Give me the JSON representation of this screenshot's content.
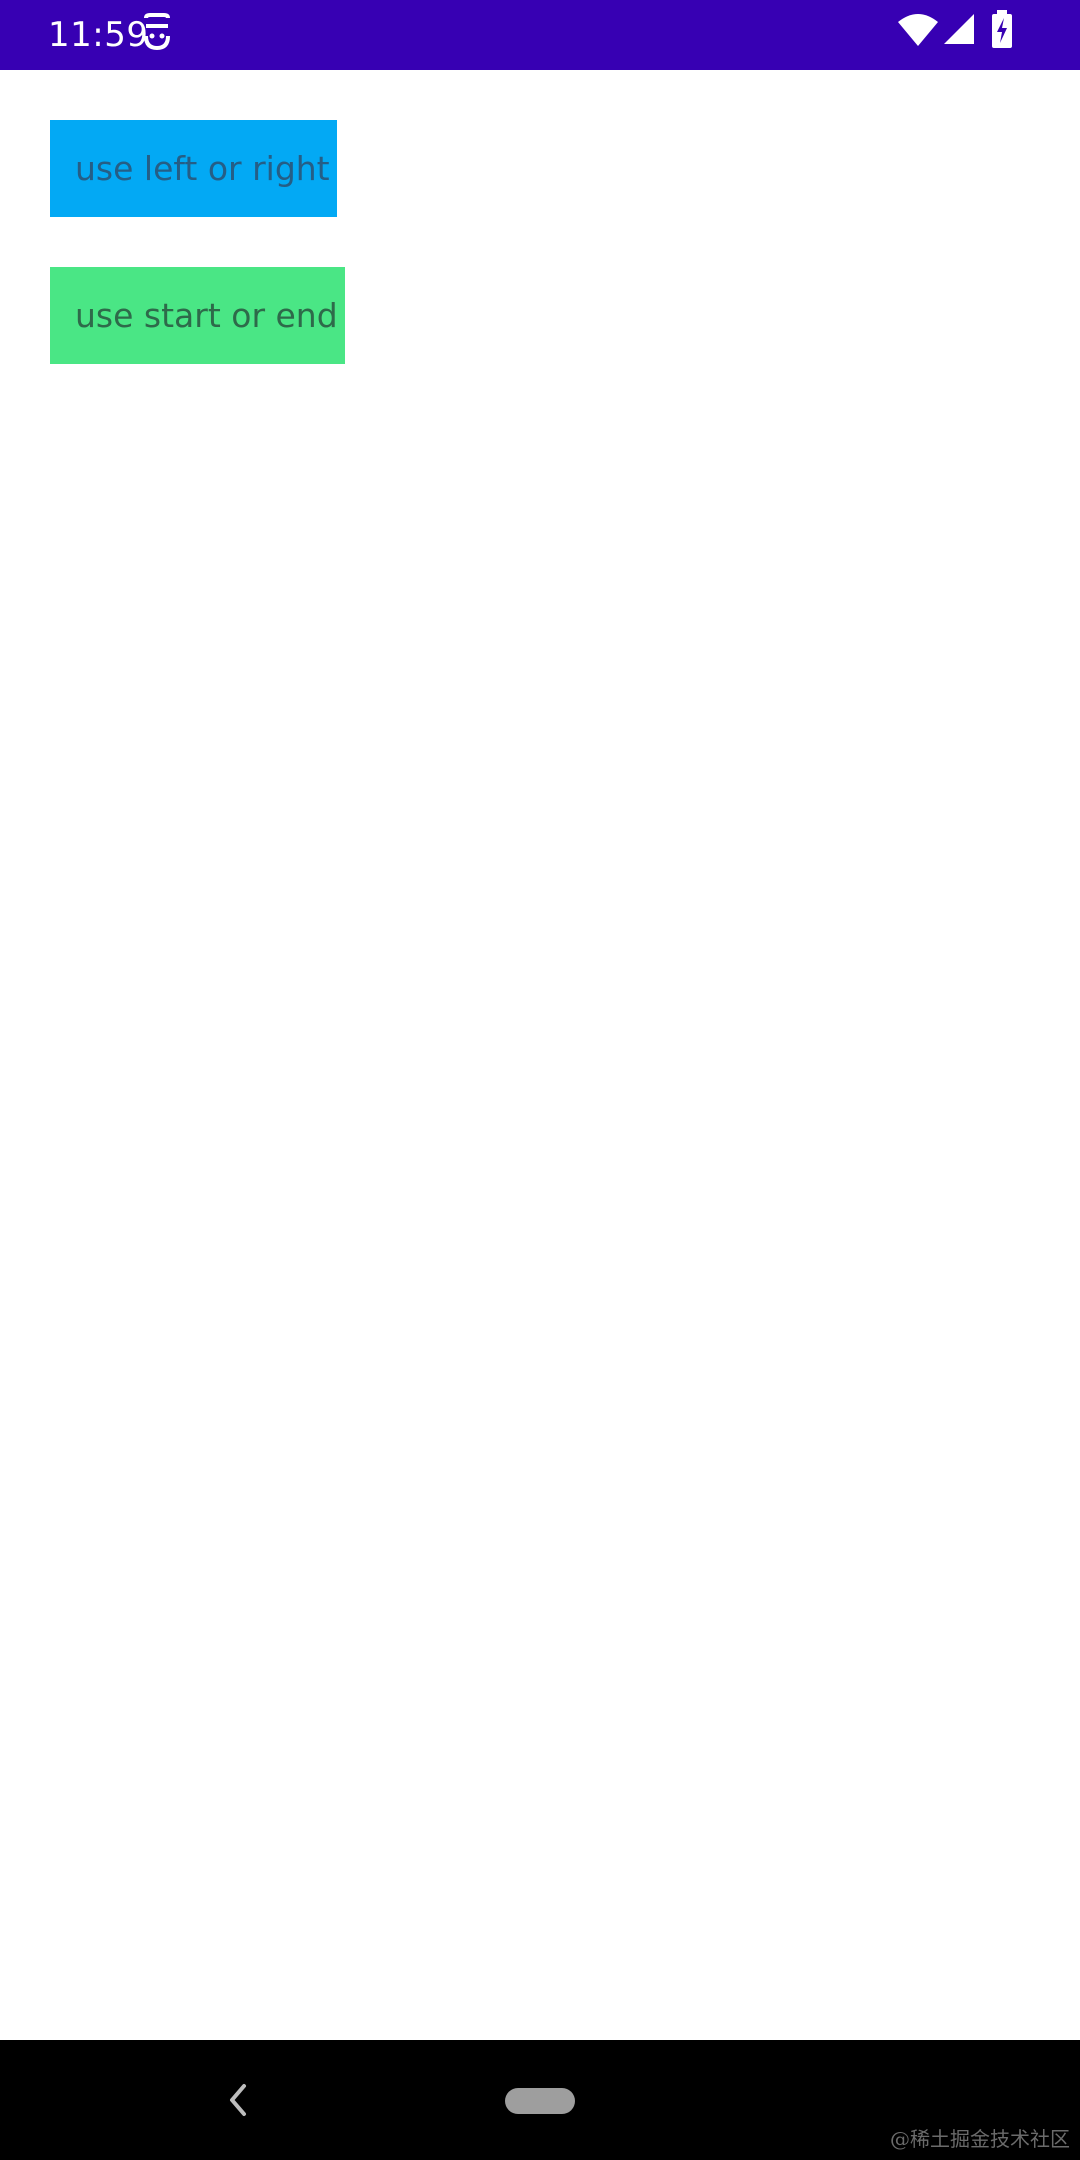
{
  "status_bar": {
    "time": "11:59",
    "background": "#3700b3",
    "icons": [
      "notification-icon",
      "wifi-icon",
      "cell-signal-icon",
      "battery-charging-icon"
    ]
  },
  "buttons": {
    "left_right_label": "use left or right",
    "start_end_label": "use start or end",
    "left_right_color": "#03a9f4",
    "start_end_color": "#4ae685"
  },
  "navigation": {
    "icons": [
      "back-icon",
      "home-pill-icon"
    ]
  },
  "watermark": "@稀土掘金技术社区"
}
